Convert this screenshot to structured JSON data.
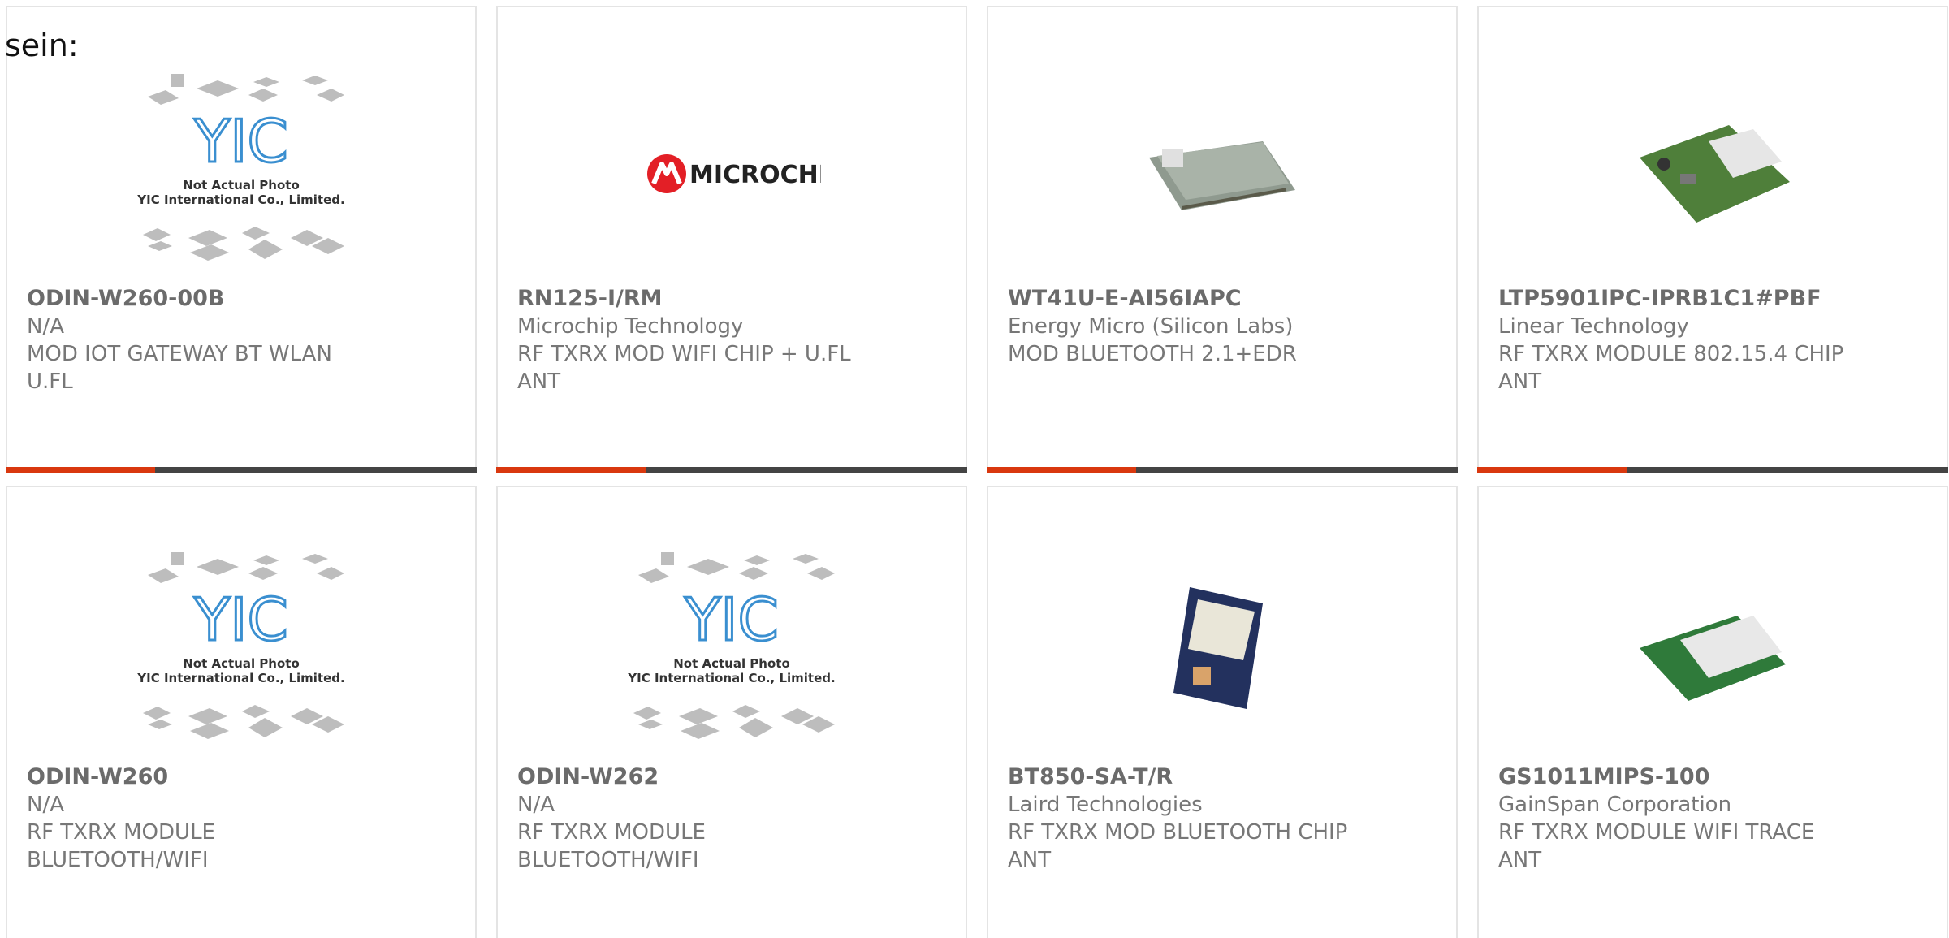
{
  "intro_text": "sein:",
  "colors": {
    "accent": "#d9380f",
    "bar": "#444444",
    "border": "#e4e4e4",
    "text": "#777777",
    "microchip_red": "#e31f26"
  },
  "placeholder": {
    "logo": "YIC",
    "line1": "Not Actual Photo",
    "line2": "YIC International Co., Limited."
  },
  "microchip_logo": "MICROCHIP",
  "products": [
    {
      "part": "ODIN-W260-00B",
      "manufacturer": "N/A",
      "description": "MOD IOT GATEWAY BT WLAN U.FL",
      "image": "placeholder"
    },
    {
      "part": "RN125-I/RM",
      "manufacturer": "Microchip Technology",
      "description": "RF TXRX MOD WIFI CHIP + U.FL ANT",
      "image": "microchip-logo"
    },
    {
      "part": "WT41U-E-AI56IAPC",
      "manufacturer": "Energy Micro (Silicon Labs)",
      "description": "MOD BLUETOOTH 2.1+EDR",
      "image": "module-photo"
    },
    {
      "part": "LTP5901IPC-IPRB1C1#PBF",
      "manufacturer": "Linear Technology",
      "description": "RF TXRX MODULE 802.15.4 CHIP ANT",
      "image": "module-photo"
    },
    {
      "part": "ODIN-W260",
      "manufacturer": "N/A",
      "description": "RF TXRX MODULE BLUETOOTH/WIFI",
      "image": "placeholder"
    },
    {
      "part": "ODIN-W262",
      "manufacturer": "N/A",
      "description": "RF TXRX MODULE BLUETOOTH/WIFI",
      "image": "placeholder"
    },
    {
      "part": "BT850-SA-T/R",
      "manufacturer": "Laird Technologies",
      "description": "RF TXRX MOD BLUETOOTH CHIP ANT",
      "image": "module-photo"
    },
    {
      "part": "GS1011MIPS-100",
      "manufacturer": "GainSpan Corporation",
      "description": "RF TXRX MODULE WIFI TRACE ANT",
      "image": "module-photo"
    }
  ]
}
